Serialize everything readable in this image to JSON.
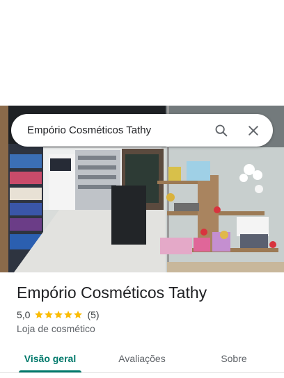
{
  "search": {
    "query": "Empório Cosméticos Tathy",
    "search_icon": "search-icon",
    "close_icon": "close-icon"
  },
  "photo": {
    "description_icon": "storefront-photo"
  },
  "place": {
    "name": "Empório Cosméticos Tathy",
    "rating": "5,0",
    "rating_value": 5,
    "stars_max": 5,
    "review_count": "(5)",
    "category": "Loja de cosmético"
  },
  "tabs": [
    {
      "label": "Visão geral",
      "active": true
    },
    {
      "label": "Avaliações",
      "active": false
    },
    {
      "label": "Sobre",
      "active": false
    }
  ],
  "colors": {
    "accent": "#00796b",
    "star": "#fbbc04",
    "text": "#202124",
    "muted": "#5f6368"
  }
}
